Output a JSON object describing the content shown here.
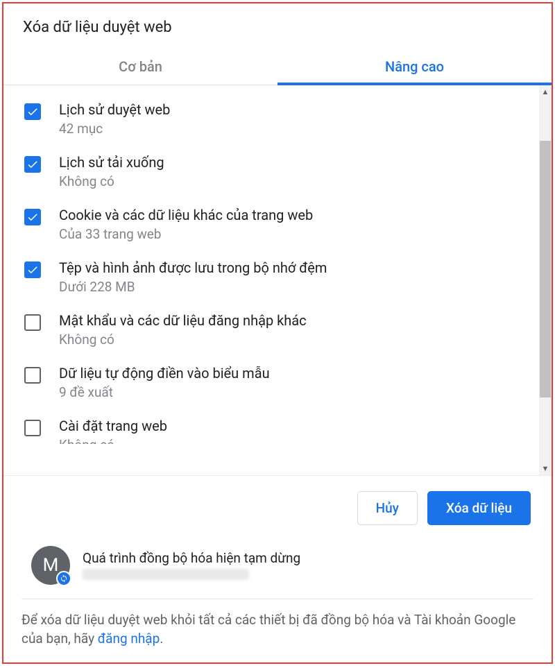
{
  "dialog": {
    "title": "Xóa dữ liệu duyệt web",
    "tabs": {
      "basic": "Cơ bản",
      "advanced": "Nâng cao"
    }
  },
  "items": [
    {
      "title": "Lịch sử duyệt web",
      "sub": "42 mục",
      "checked": true
    },
    {
      "title": "Lịch sử tải xuống",
      "sub": "Không có",
      "checked": true
    },
    {
      "title": "Cookie và các dữ liệu khác của trang web",
      "sub": "Của 33 trang web",
      "checked": true
    },
    {
      "title": "Tệp và hình ảnh được lưu trong bộ nhớ đệm",
      "sub": "Dưới 228 MB",
      "checked": true
    },
    {
      "title": "Mật khẩu và các dữ liệu đăng nhập khác",
      "sub": "Không có",
      "checked": false
    },
    {
      "title": "Dữ liệu tự động điền vào biểu mẫu",
      "sub": "9 đề xuất",
      "checked": false
    },
    {
      "title": "Cài đặt trang web",
      "sub": "Không có",
      "checked": false
    }
  ],
  "buttons": {
    "cancel": "Hủy",
    "clear": "Xóa dữ liệu"
  },
  "sync": {
    "avatar_initial": "M",
    "title": "Quá trình đồng bộ hóa hiện tạm dừng"
  },
  "footer": {
    "text_before": "Để xóa dữ liệu duyệt web khỏi tất cả các thiết bị đã đồng bộ hóa và Tài khoản Google của bạn, hãy ",
    "link": "đăng nhập",
    "text_after": "."
  }
}
